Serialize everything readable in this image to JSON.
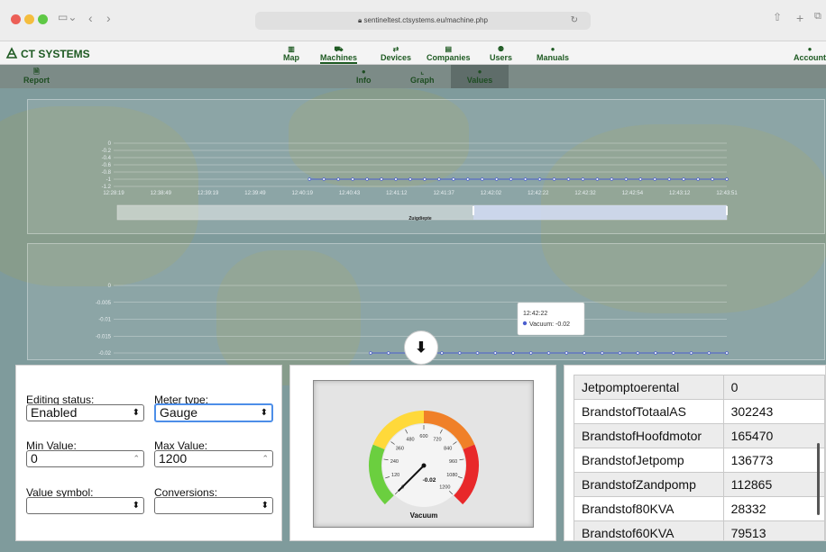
{
  "browser": {
    "url": "sentineltest.ctsystems.eu/machine.php"
  },
  "header": {
    "brand": "CT SYSTEMS",
    "nav": [
      {
        "label": "Map",
        "icon": "map-icon"
      },
      {
        "label": "Machines",
        "icon": "car-icon"
      },
      {
        "label": "Devices",
        "icon": "usb-icon"
      },
      {
        "label": "Companies",
        "icon": "building-icon"
      },
      {
        "label": "Users",
        "icon": "users-icon"
      },
      {
        "label": "Manuals",
        "icon": "info-icon"
      }
    ],
    "account": "Account"
  },
  "subnav": {
    "report": "Report",
    "tabs": [
      {
        "label": "Info",
        "icon": "info-icon"
      },
      {
        "label": "Graph",
        "icon": "graph-icon"
      },
      {
        "label": "Values",
        "icon": "info-icon"
      }
    ]
  },
  "chart_data": [
    {
      "type": "line",
      "title": "",
      "ylabel": "",
      "xlabel": "",
      "x": [
        "12:28:19",
        "12:38:49",
        "12:39:19",
        "12:39:49",
        "12:40:19",
        "12:40:43",
        "12:41:12",
        "12:41:37",
        "12:42:02",
        "12:42:22",
        "12:42:32",
        "12:42:54",
        "12:43:12",
        "12:43:51"
      ],
      "y_ticks": [
        "0",
        "-0.2",
        "-0.4",
        "-0.6",
        "-0.8",
        "-1",
        "-1.2"
      ],
      "ylim": [
        -1.2,
        0
      ],
      "series": [
        {
          "name": "",
          "values": [
            -1,
            -1,
            -1,
            -1,
            -1,
            -1,
            -1,
            -1,
            -1,
            -1,
            -1,
            -1,
            -1,
            -1,
            -1,
            -1,
            -1,
            -1,
            -1,
            -1,
            -1,
            -1,
            -1,
            -1,
            -1,
            -1,
            -1,
            -1,
            -1,
            -1
          ]
        }
      ],
      "navigator_label": "Zuigdiepte",
      "color": "#4b5fcf"
    },
    {
      "type": "line",
      "title": "",
      "y_ticks": [
        "0",
        "-0.005",
        "-0.01",
        "-0.015",
        "-0.02"
      ],
      "ylim": [
        -0.02,
        0
      ],
      "series": [
        {
          "name": "Vacuum",
          "values": [
            -0.02,
            -0.02,
            -0.02,
            -0.02,
            -0.02,
            -0.02,
            -0.02,
            -0.02,
            -0.02,
            -0.02,
            -0.02,
            -0.02,
            -0.02,
            -0.02,
            -0.02,
            -0.02,
            -0.02,
            -0.02,
            -0.02,
            -0.02,
            -0.02
          ]
        }
      ],
      "tooltip": {
        "time": "12:42:22",
        "series": "Vacuum",
        "value": "-0.02"
      },
      "color": "#4b5fcf"
    }
  ],
  "editor": {
    "editing_status_label": "Editing status:",
    "editing_status_value": "Enabled",
    "meter_type_label": "Meter type:",
    "meter_type_value": "Gauge",
    "min_label": "Min Value:",
    "min_value": "0",
    "max_label": "Max Value:",
    "max_value": "1200",
    "symbol_label": "Value symbol:",
    "symbol_value": "",
    "conversions_label": "Conversions:",
    "conversions_value": ""
  },
  "gauge": {
    "title": "Vacuum",
    "value": "-0.02",
    "ticks": [
      "0",
      "120",
      "240",
      "360",
      "480",
      "600",
      "720",
      "840",
      "960",
      "1080",
      "1200"
    ],
    "needle_value": -0.02,
    "min": 0,
    "max": 1200
  },
  "values_table": [
    {
      "key": "Jetpomptoerental",
      "value": "0"
    },
    {
      "key": "BrandstofTotaalAS",
      "value": "302243"
    },
    {
      "key": "BrandstofHoofdmotor",
      "value": "165470"
    },
    {
      "key": "BrandstofJetpomp",
      "value": "136773"
    },
    {
      "key": "BrandstofZandpomp",
      "value": "112865"
    },
    {
      "key": "Brandstof80KVA",
      "value": "28332"
    },
    {
      "key": "Brandstof60KVA",
      "value": "79513"
    }
  ],
  "scroll_down_icon": "arrow-down-icon"
}
